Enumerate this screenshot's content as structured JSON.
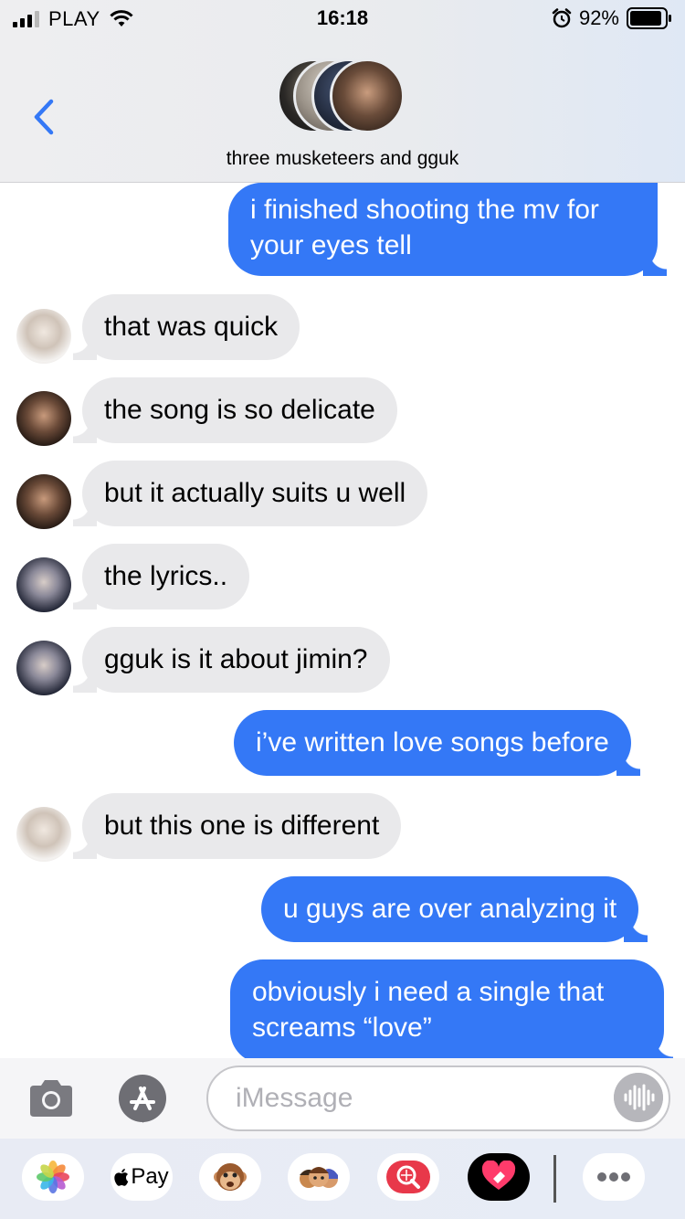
{
  "status_bar": {
    "carrier": "PLAY",
    "time": "16:18",
    "battery": "92%",
    "battery_level": 0.92
  },
  "header": {
    "group_name": "three musketeers and gguk"
  },
  "messages": [
    {
      "dir": "out",
      "text": [
        "i finished shooting the mv for",
        "your eyes tell"
      ]
    },
    {
      "dir": "in",
      "avatar": "light",
      "text": [
        "that was quick"
      ]
    },
    {
      "dir": "in",
      "avatar": "dark",
      "text": [
        "the song is so delicate"
      ]
    },
    {
      "dir": "in",
      "avatar": "dark",
      "text": [
        "but it actually suits u well"
      ]
    },
    {
      "dir": "in",
      "avatar": "cool",
      "text": [
        "the lyrics.."
      ]
    },
    {
      "dir": "in",
      "avatar": "cool",
      "text": [
        "gguk is it about jimin?"
      ]
    },
    {
      "dir": "out",
      "text": [
        "i’ve written love songs before"
      ]
    },
    {
      "dir": "in",
      "avatar": "light",
      "text": [
        "but this one is different"
      ]
    },
    {
      "dir": "out",
      "text": [
        "u guys are over analyzing it"
      ]
    },
    {
      "dir": "out",
      "text": [
        "obviously i need a single that",
        "screams “love”"
      ]
    }
  ],
  "input": {
    "placeholder": "iMessage"
  },
  "apps": [
    {
      "name": "photos-app-icon"
    },
    {
      "name": "apple-pay-app-icon",
      "label": "Pay"
    },
    {
      "name": "animoji-app-icon"
    },
    {
      "name": "memoji-app-icon"
    },
    {
      "name": "images-search-app-icon"
    },
    {
      "name": "digital-touch-app-icon"
    },
    {
      "name": "more-apps-icon"
    }
  ],
  "colors": {
    "outgoing": "#3478f6",
    "incoming": "#e9e9eb",
    "tint": "#3478f6"
  }
}
